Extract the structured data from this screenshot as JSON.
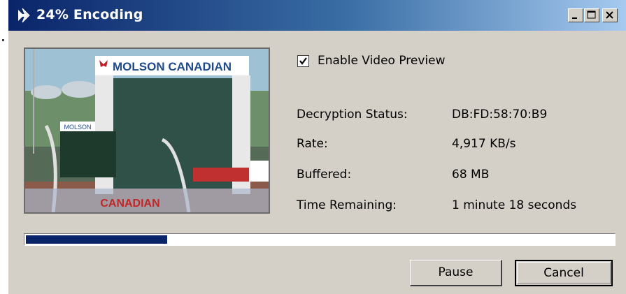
{
  "window": {
    "title": "24% Encoding",
    "controls": {
      "minimize": "minimize-icon",
      "maximize": "maximize-icon",
      "close": "close-icon"
    }
  },
  "preview": {
    "enable_label": "Enable Video Preview",
    "enabled": true,
    "billboard_text": "MOLSON CANADIAN",
    "side_sign_text": "MOLSON",
    "bottom_sign_text": "CANADIAN"
  },
  "status": {
    "rows": [
      {
        "label": "Decryption Status:",
        "value": "DB:FD:58:70:B9"
      },
      {
        "label": "Rate:",
        "value": "4,917 KB/s"
      },
      {
        "label": "Buffered:",
        "value": "68 MB"
      },
      {
        "label": "Time Remaining:",
        "value": "1 minute 18 seconds"
      }
    ]
  },
  "progress": {
    "percent": 24
  },
  "buttons": {
    "pause": "Pause",
    "cancel": "Cancel"
  },
  "colors": {
    "title_start": "#0a246a",
    "title_end": "#a6caf0",
    "progress": "#0a246a",
    "dialog_bg": "#d4d0c8"
  }
}
